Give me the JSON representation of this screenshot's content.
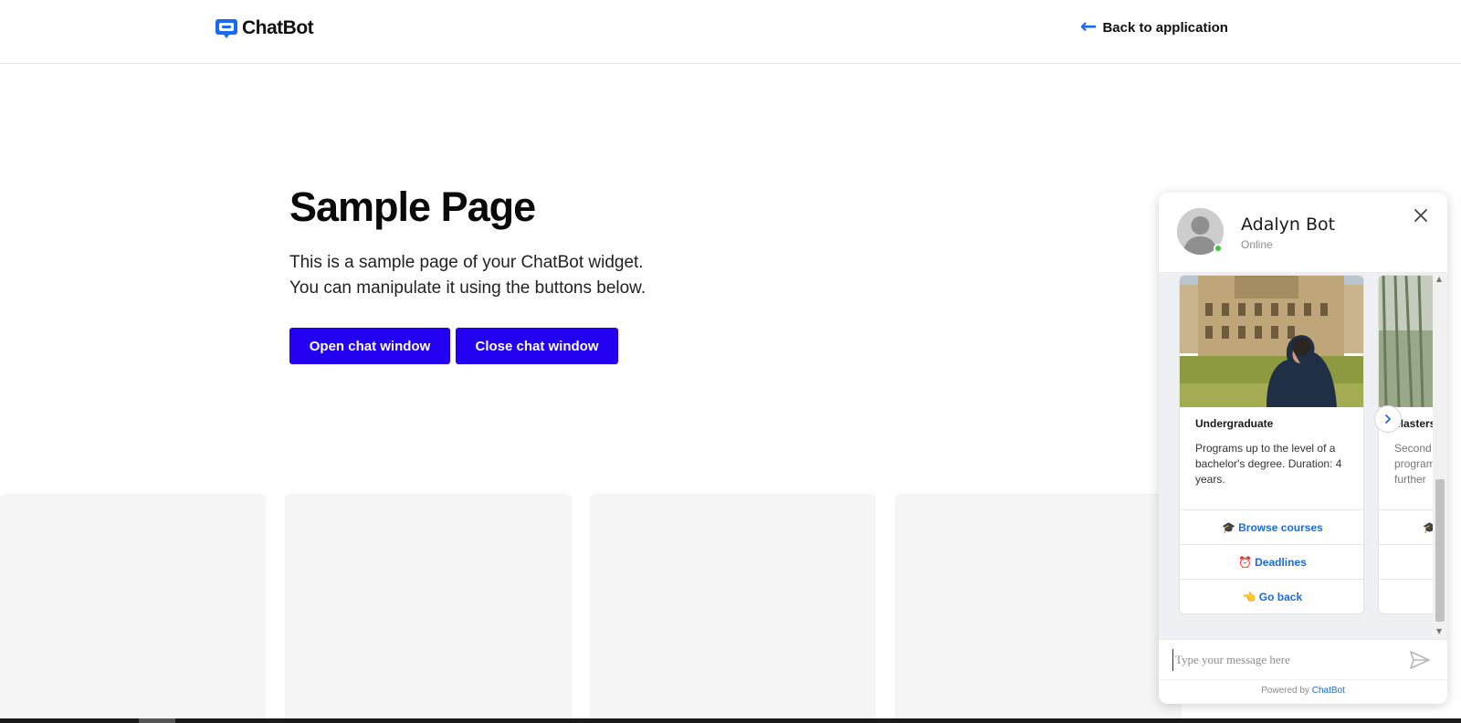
{
  "header": {
    "logo_text": "ChatBot",
    "back_link": "Back to application",
    "back_arrow": "←"
  },
  "hero": {
    "title": "Sample Page",
    "subtitle_line1": "This is a sample page of your ChatBot widget.",
    "subtitle_line2": "You can manipulate it using the buttons below.",
    "open_button": "Open chat window",
    "close_button": "Close chat window"
  },
  "colors": {
    "accent": "#2300f0",
    "link_blue": "#1b6bdc",
    "online_green": "#3cc83c"
  },
  "chat": {
    "bot_name": "Adalyn Bot",
    "status": "Online",
    "close_icon": "close-icon",
    "cards": [
      {
        "title": "Undergraduate",
        "description": "Programs up to the level of a bachelor's degree. Duration: 4 years.",
        "buttons": [
          {
            "emoji": "🎓",
            "label": "Browse courses"
          },
          {
            "emoji": "⏰",
            "label": "Deadlines"
          },
          {
            "emoji": "👈",
            "label": "Go back"
          }
        ]
      },
      {
        "title": "Masters",
        "description": "Second programs further",
        "buttons": [
          {
            "emoji": "🎓",
            "label": ""
          }
        ]
      }
    ],
    "input_placeholder": "Type your message here",
    "powered_prefix": "Powered by",
    "powered_brand": "ChatBot"
  }
}
